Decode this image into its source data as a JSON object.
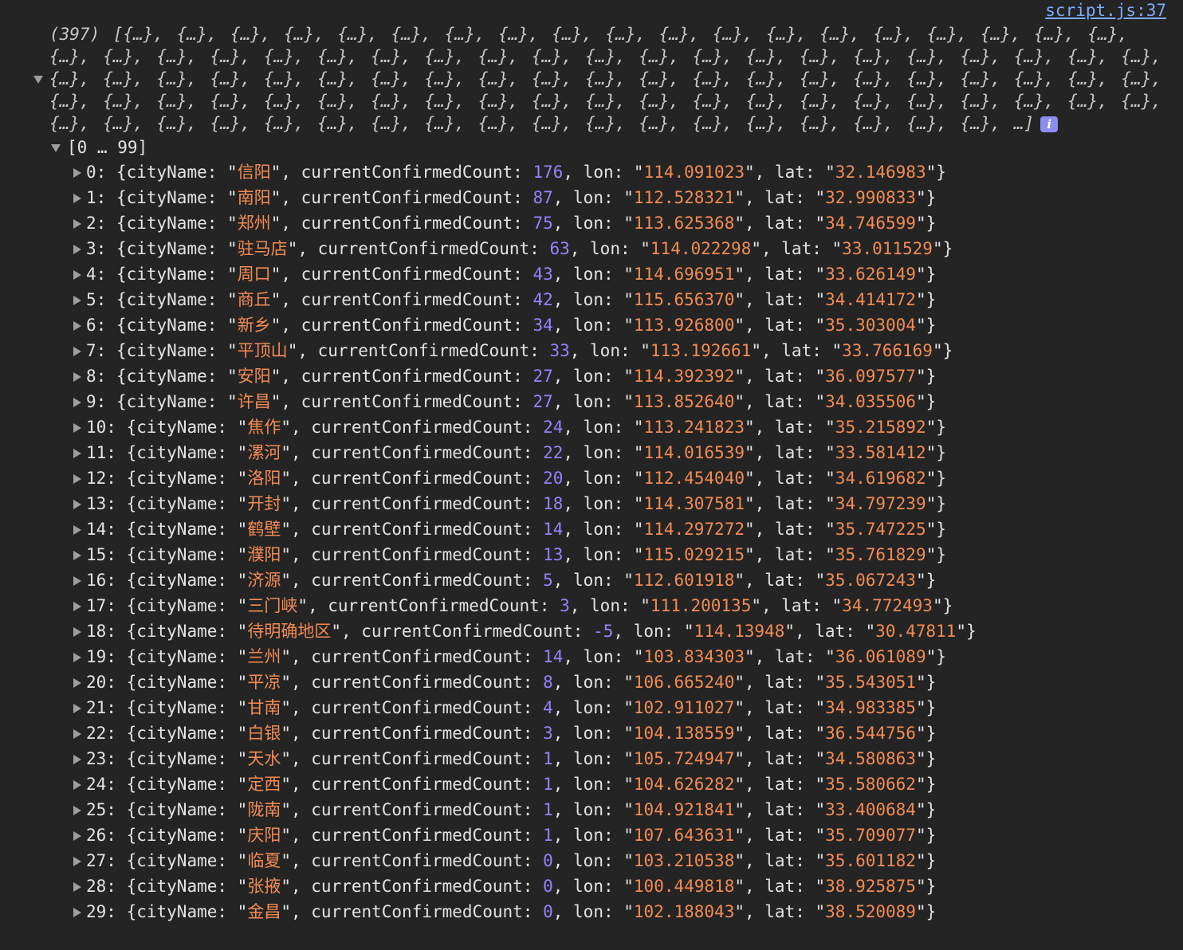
{
  "source_link": "script.js:37",
  "summary": {
    "text": "(397) [{…}, {…}, {…}, {…}, {…}, {…}, {…}, {…}, {…}, {…}, {…}, {…}, {…}, {…}, {…}, {…}, {…}, {…}, {…}, {…}, {…}, {…}, {…}, {…}, {…}, {…}, {…}, {…}, {…}, {…}, {…}, {…}, {…}, {…}, {…}, {…}, {…}, {…}, {…}, {…}, {…}, {…}, {…}, {…}, {…}, {…}, {…}, {…}, {…}, {…}, {…}, {…}, {…}, {…}, {…}, {…}, {…}, {…}, {…}, {…}, {…}, {…}, {…}, {…}, {…}, {…}, {…}, {…}, {…}, {…}, {…}, {…}, {…}, {…}, {…}, {…}, {…}, {…}, {…}, {…}, {…}, {…}, {…}, {…}, {…}, {…}, {…}, {…}, {…}, {…}, {…}, {…}, {…}, {…}, {…}, {…}, {…}, {…}, {…}, {…}, …]",
    "info_badge": "i"
  },
  "range_label": "[0 … 99]",
  "keys": {
    "city": "cityName",
    "count": "currentConfirmedCount",
    "lon": "lon",
    "lat": "lat"
  },
  "rows": [
    {
      "index": "0",
      "cityName": "信阳",
      "count": "176",
      "lon": "114.091023",
      "lat": "32.146983"
    },
    {
      "index": "1",
      "cityName": "南阳",
      "count": "87",
      "lon": "112.528321",
      "lat": "32.990833"
    },
    {
      "index": "2",
      "cityName": "郑州",
      "count": "75",
      "lon": "113.625368",
      "lat": "34.746599"
    },
    {
      "index": "3",
      "cityName": "驻马店",
      "count": "63",
      "lon": "114.022298",
      "lat": "33.011529"
    },
    {
      "index": "4",
      "cityName": "周口",
      "count": "43",
      "lon": "114.696951",
      "lat": "33.626149"
    },
    {
      "index": "5",
      "cityName": "商丘",
      "count": "42",
      "lon": "115.656370",
      "lat": "34.414172"
    },
    {
      "index": "6",
      "cityName": "新乡",
      "count": "34",
      "lon": "113.926800",
      "lat": "35.303004"
    },
    {
      "index": "7",
      "cityName": "平顶山",
      "count": "33",
      "lon": "113.192661",
      "lat": "33.766169"
    },
    {
      "index": "8",
      "cityName": "安阳",
      "count": "27",
      "lon": "114.392392",
      "lat": "36.097577"
    },
    {
      "index": "9",
      "cityName": "许昌",
      "count": "27",
      "lon": "113.852640",
      "lat": "34.035506"
    },
    {
      "index": "10",
      "cityName": "焦作",
      "count": "24",
      "lon": "113.241823",
      "lat": "35.215892"
    },
    {
      "index": "11",
      "cityName": "漯河",
      "count": "22",
      "lon": "114.016539",
      "lat": "33.581412"
    },
    {
      "index": "12",
      "cityName": "洛阳",
      "count": "20",
      "lon": "112.454040",
      "lat": "34.619682"
    },
    {
      "index": "13",
      "cityName": "开封",
      "count": "18",
      "lon": "114.307581",
      "lat": "34.797239"
    },
    {
      "index": "14",
      "cityName": "鹤壁",
      "count": "14",
      "lon": "114.297272",
      "lat": "35.747225"
    },
    {
      "index": "15",
      "cityName": "濮阳",
      "count": "13",
      "lon": "115.029215",
      "lat": "35.761829"
    },
    {
      "index": "16",
      "cityName": "济源",
      "count": "5",
      "lon": "112.601918",
      "lat": "35.067243"
    },
    {
      "index": "17",
      "cityName": "三门峡",
      "count": "3",
      "lon": "111.200135",
      "lat": "34.772493"
    },
    {
      "index": "18",
      "cityName": "待明确地区",
      "count": "-5",
      "lon": "114.13948",
      "lat": "30.47811"
    },
    {
      "index": "19",
      "cityName": "兰州",
      "count": "14",
      "lon": "103.834303",
      "lat": "36.061089"
    },
    {
      "index": "20",
      "cityName": "平凉",
      "count": "8",
      "lon": "106.665240",
      "lat": "35.543051"
    },
    {
      "index": "21",
      "cityName": "甘南",
      "count": "4",
      "lon": "102.911027",
      "lat": "34.983385"
    },
    {
      "index": "22",
      "cityName": "白银",
      "count": "3",
      "lon": "104.138559",
      "lat": "36.544756"
    },
    {
      "index": "23",
      "cityName": "天水",
      "count": "1",
      "lon": "105.724947",
      "lat": "34.580863"
    },
    {
      "index": "24",
      "cityName": "定西",
      "count": "1",
      "lon": "104.626282",
      "lat": "35.580662"
    },
    {
      "index": "25",
      "cityName": "陇南",
      "count": "1",
      "lon": "104.921841",
      "lat": "33.400684"
    },
    {
      "index": "26",
      "cityName": "庆阳",
      "count": "1",
      "lon": "107.643631",
      "lat": "35.709077"
    },
    {
      "index": "27",
      "cityName": "临夏",
      "count": "0",
      "lon": "103.210538",
      "lat": "35.601182"
    },
    {
      "index": "28",
      "cityName": "张掖",
      "count": "0",
      "lon": "100.449818",
      "lat": "38.925875"
    },
    {
      "index": "29",
      "cityName": "金昌",
      "count": "0",
      "lon": "102.188043",
      "lat": "38.520089"
    }
  ]
}
